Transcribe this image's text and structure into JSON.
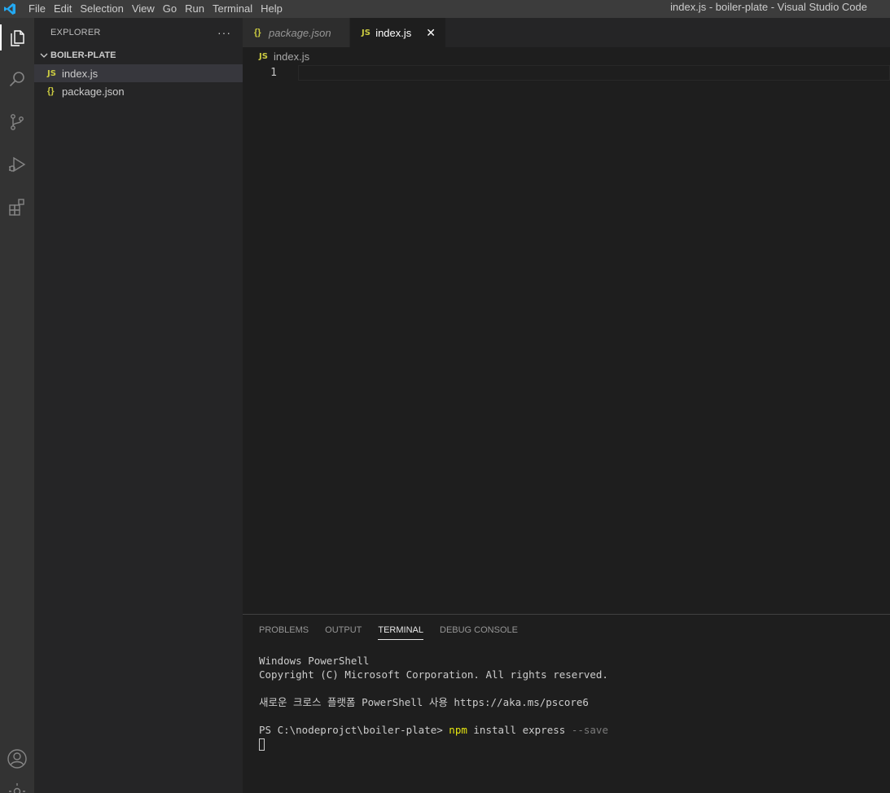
{
  "titlebar": {
    "menu": [
      "File",
      "Edit",
      "Selection",
      "View",
      "Go",
      "Run",
      "Terminal",
      "Help"
    ],
    "window_title": "index.js - boiler-plate - Visual Studio Code"
  },
  "activitybar": {
    "icons": [
      "explorer-icon",
      "search-icon",
      "source-control-icon",
      "run-debug-icon",
      "extensions-icon",
      "account-icon",
      "settings-icon"
    ]
  },
  "sidebar": {
    "title": "EXPLORER",
    "more": "···",
    "folder": "BOILER-PLATE",
    "files": [
      {
        "icon": "JS",
        "name": "index.js"
      },
      {
        "icon": "{}",
        "name": "package.json"
      }
    ]
  },
  "tabs": [
    {
      "icon": "{}",
      "label": "package.json"
    },
    {
      "icon": "JS",
      "label": "index.js",
      "close": "✕"
    }
  ],
  "breadcrumb": {
    "icon": "JS",
    "file": "index.js"
  },
  "editor": {
    "line_number": "1"
  },
  "panel": {
    "tabs": [
      "PROBLEMS",
      "OUTPUT",
      "TERMINAL",
      "DEBUG CONSOLE"
    ],
    "terminal": {
      "line1": "Windows PowerShell",
      "line2": "Copyright (C) Microsoft Corporation. All rights reserved.",
      "line3": "새로운 크로스 플랫폼 PowerShell 사용 https://aka.ms/pscore6",
      "prompt": "PS C:\\nodeprojct\\boiler-plate> ",
      "cmd": "npm",
      "args": " install express ",
      "flag": "--save"
    }
  },
  "colors": {
    "accent": "#007acc",
    "js_icon": "#cbcb41",
    "logo": "#23a9f2"
  }
}
